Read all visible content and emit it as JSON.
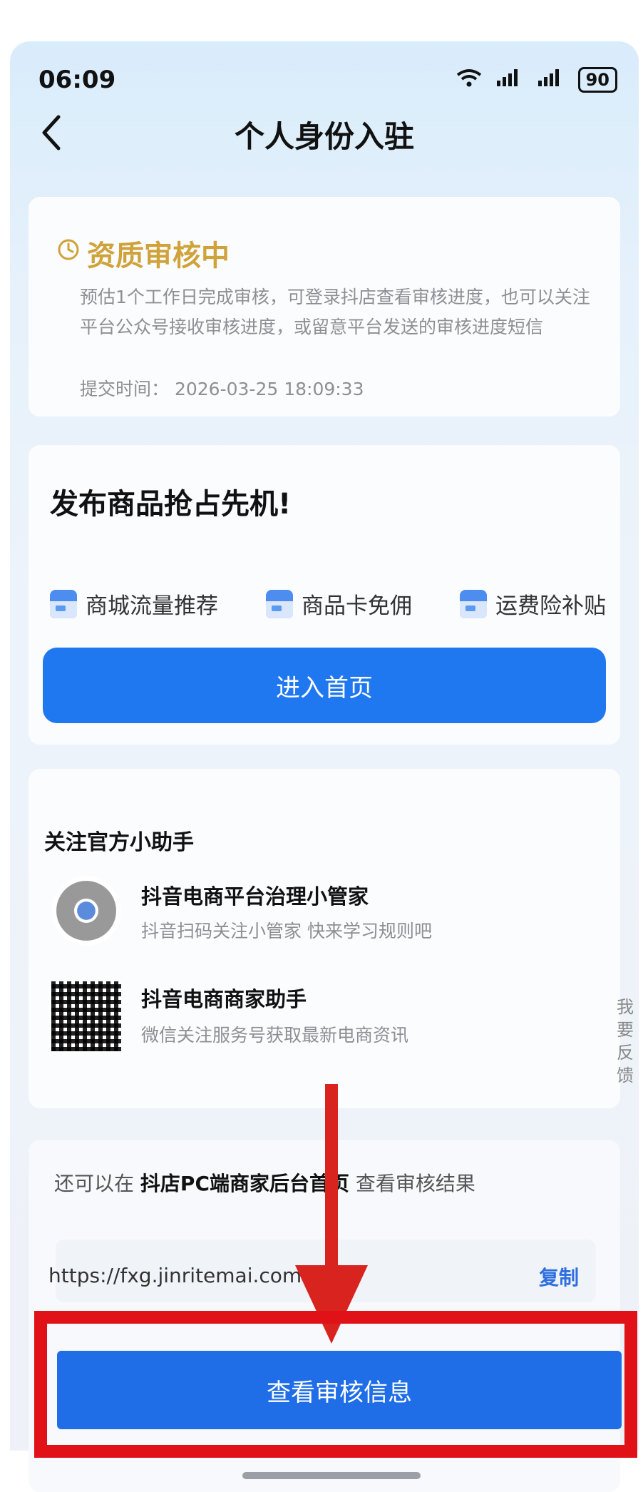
{
  "status_bar": {
    "time": "06:09",
    "wifi": "WiFi",
    "signal1": "5G",
    "signal2": "5G",
    "battery": "90"
  },
  "header": {
    "title": "个人身份入驻"
  },
  "status_card": {
    "title": "资质审核中",
    "description": "预估1个工作日完成审核，可登录抖店查看审核进度，也可以关注平台公众号接收审核进度，或留意平台发送的审核进度短信",
    "submit_time_label": "提交时间：",
    "submit_time": "2026-03-25 18:09:33"
  },
  "promo_card": {
    "title": "发布商品抢占先机!",
    "benefits": [
      "商城流量推荐",
      "商品卡免佣",
      "运费险补贴"
    ],
    "button_label": "进入首页"
  },
  "follow_card": {
    "title": "关注官方小助手",
    "items": [
      {
        "name": "抖音电商平台治理小管家",
        "subtitle": "抖音扫码关注小管家 快来学习规则吧"
      },
      {
        "name": "抖音电商商家助手",
        "subtitle": "微信关注服务号获取最新电商资讯"
      }
    ]
  },
  "feedback_label": "我要反馈",
  "pc_card": {
    "prefix": "还可以在",
    "highlight": "抖店PC端商家后台首页",
    "suffix": "查看审核结果",
    "url": "https://fxg.jinritemai.com",
    "copy_label": "复制"
  },
  "bottom_button": {
    "label": "查看审核信息"
  },
  "colors": {
    "primary": "#1f78f0",
    "warning": "#cfa23a",
    "annotation": "#e01218"
  }
}
